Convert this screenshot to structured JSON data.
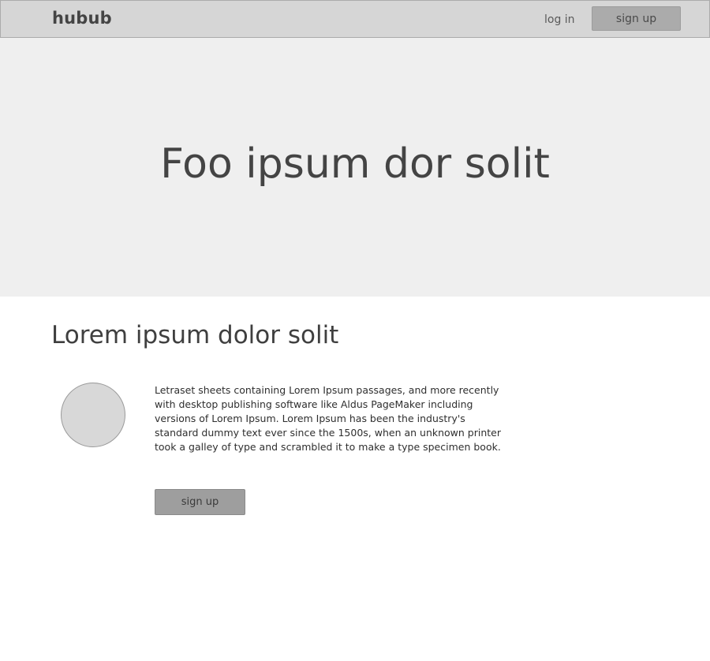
{
  "nav": {
    "brand": "hubub",
    "login_label": "log in",
    "signup_label": "sign up"
  },
  "hero": {
    "title": "Foo ipsum dor solit"
  },
  "content": {
    "heading": "Lorem ipsum dolor solit",
    "body": "Letraset sheets containing Lorem Ipsum passages, and more recently with desktop publishing software like Aldus PageMaker including versions of Lorem Ipsum. Lorem Ipsum has been the industry's standard dummy text ever since the 1500s, when an unknown printer took a galley of type and scrambled it to make a type specimen book.",
    "signup_label": "sign up"
  },
  "colors": {
    "navbar_bg": "#d6d6d6",
    "hero_bg": "#efefef",
    "nav_button_bg": "#ababab",
    "cta_button_bg": "#9e9e9e",
    "avatar_bg": "#d8d8d8"
  }
}
